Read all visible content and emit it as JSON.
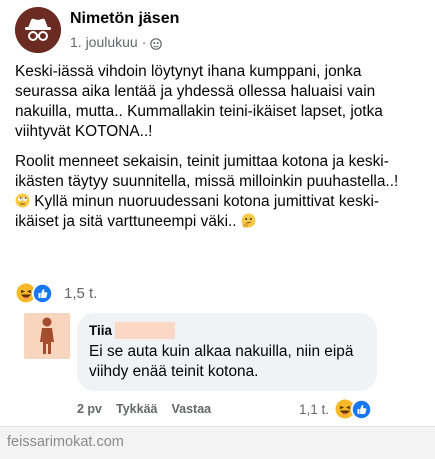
{
  "post": {
    "author": "Nimetön jäsen",
    "date": "1. joulukuu",
    "separator": "·",
    "paragraphs": [
      "Keski-iässä vihdoin löytynyt ihana kumppani, jonka seurassa aika lentää ja yhdessä ollessa haluaisi vain nakuilla, mutta.. Kummallakin teini-ikäiset lapset, jotka viihtyvät KOTONA..!",
      "Roolit menneet sekaisin, teinit jumittaa kotona ja keski-ikästen täytyy suunnitella, missä milloinkin puuhastella..!",
      "Kyllä minun nuoruudessani kotona jumittivat keski-ikäiset ja sitä varttuneempi väki.."
    ],
    "icons": [
      "anonymous-member-icon",
      "globe-icon",
      "eye-roll-emoji-icon",
      "thinking-emoji-icon"
    ],
    "reactions": {
      "count": "1,5 t.",
      "icons": [
        "haha-reaction-icon",
        "like-reaction-icon"
      ]
    }
  },
  "comment": {
    "author": "Tiia",
    "text": "Ei se auta kuin alkaa nakuilla, niin eipä viihdy enää teinit kotona.",
    "time": "2 pv",
    "like_label": "Tykkää",
    "reply_label": "Vastaa",
    "reactions_count": "1,1 t."
  },
  "footer": {
    "site": "feissarimokat.com"
  },
  "colors": {
    "avatar_bg": "#6b2a22",
    "comment_avatar_bg": "#f8d5bd",
    "bubble_bg": "#f0f2f5",
    "meta_text": "#65676b",
    "like_blue": "#1877f2",
    "haha_yellow": "#f7b928"
  }
}
